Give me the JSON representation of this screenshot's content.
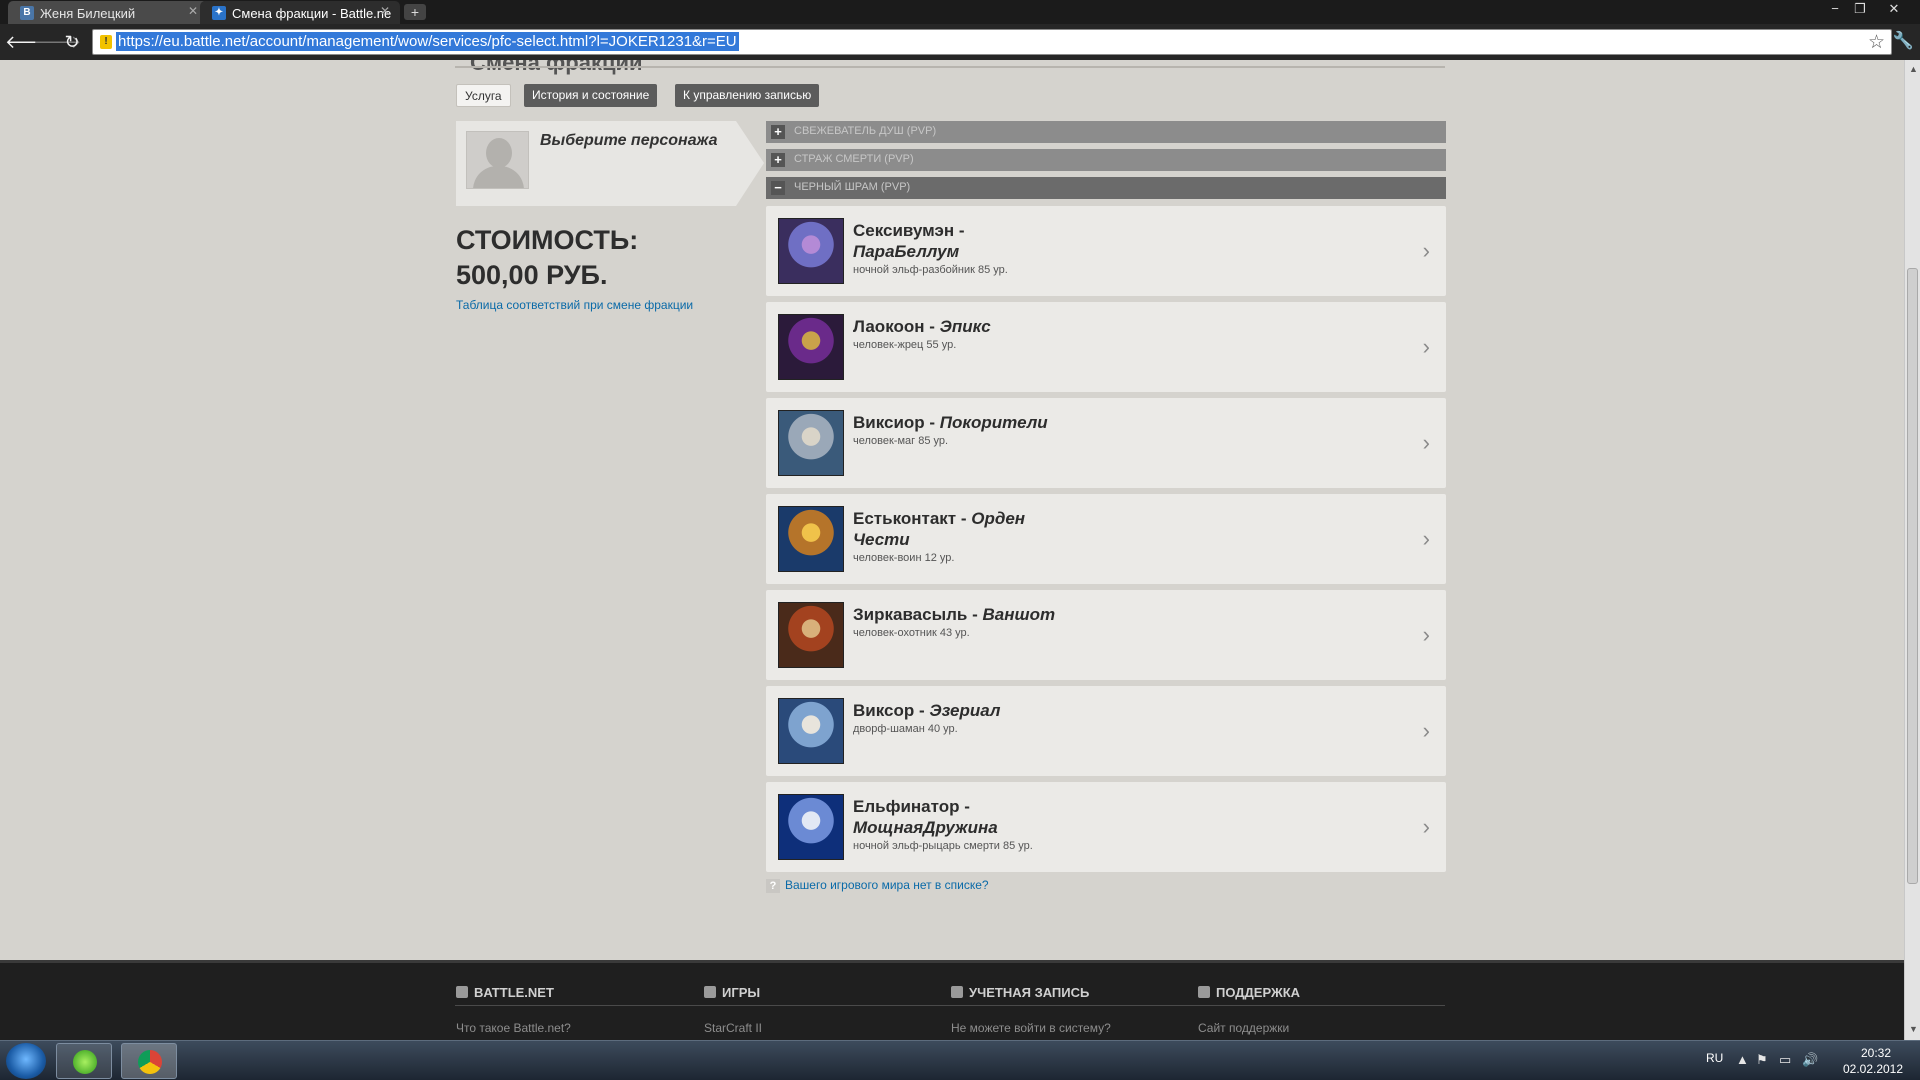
{
  "browser": {
    "tabs": [
      {
        "label": "Женя Билецкий",
        "favicon": "B",
        "favicon_color": "#4a76a8",
        "active": false
      },
      {
        "label": "Смена фракции - Battle.ne",
        "favicon": "✦",
        "favicon_color": "#2a73c9",
        "active": true
      }
    ],
    "new_tab": "+",
    "url": "https://eu.battle.net/account/management/wow/services/pfc-select.html?l=JOKER1231&r=EU",
    "window_controls": {
      "minimize": "−",
      "restore": "❐",
      "close": "✕"
    }
  },
  "page": {
    "header_title": "Смена фракции",
    "tabs": {
      "service": "Услуга",
      "history": "История и состояние",
      "manage": "К управлению записью"
    },
    "select_character": "Выберите персонажа",
    "price_title": "СТОИМОСТЬ:",
    "price_value": "500,00 РУБ.",
    "faction_table_link": "Таблица соответствий при смене фракции",
    "realms": [
      {
        "name": "СВЕЖЕВАТЕЛЬ ДУШ (PVP)",
        "toggle": "+",
        "expanded": false
      },
      {
        "name": "СТРАЖ СМЕРТИ (PVP)",
        "toggle": "+",
        "expanded": false
      },
      {
        "name": "ЧЕРНЫЙ ШРАМ (PVP)",
        "toggle": "−",
        "expanded": true
      }
    ],
    "characters": [
      {
        "name": "Сексивумэн - ",
        "guild": "ПараБеллум",
        "meta": "ночной эльф-разбойник 85 ур.",
        "portrait_colors": [
          "#3a2e5e",
          "#6f6fc4",
          "#b48ad6"
        ]
      },
      {
        "name": "Лаокоон - ",
        "guild": "Эпикс",
        "meta": "человек-жрец 55 ур.",
        "portrait_colors": [
          "#2b1a3a",
          "#6a2a8a",
          "#c9a24a"
        ]
      },
      {
        "name": "Виксиор - ",
        "guild": "Покорители",
        "meta": "человек-маг 85 ур.",
        "portrait_colors": [
          "#3a5a7a",
          "#9aa8b8",
          "#d9d4c8"
        ]
      },
      {
        "name": "Естьконтакт - ",
        "guild": "Орден Чести",
        "meta": "человек-воин 12 ур.",
        "portrait_colors": [
          "#1a3a6a",
          "#b5742a",
          "#f0c24a"
        ]
      },
      {
        "name": "Зиркавасыль - ",
        "guild": "Ваншот",
        "meta": "человек-охотник 43 ур.",
        "portrait_colors": [
          "#4a2a1a",
          "#a3421f",
          "#d8b07a"
        ]
      },
      {
        "name": "Виксор - ",
        "guild": "Эзериал",
        "meta": "дворф-шаман 40 ур.",
        "portrait_colors": [
          "#2a4a7a",
          "#7ea3cf",
          "#e8e4dc"
        ]
      },
      {
        "name": "Ельфинатор - ",
        "guild": "МощнаяДружина",
        "meta": "ночной эльф-рыцарь смерти 85 ур.",
        "portrait_colors": [
          "#0e2f7a",
          "#6b8ad4",
          "#e2e8f4"
        ]
      }
    ],
    "missing_realm_icon": "?",
    "missing_realm": "Вашего игрового мира нет в списке?"
  },
  "footer": {
    "columns": [
      {
        "title": "BATTLE.NET",
        "link": "Что такое Battle.net?"
      },
      {
        "title": "ИГРЫ",
        "link": "StarCraft II"
      },
      {
        "title": "УЧЕТНАЯ ЗАПИСЬ",
        "link": "Не можете войти в систему?"
      },
      {
        "title": "ПОДДЕРЖКА",
        "link": "Сайт поддержки"
      }
    ]
  },
  "taskbar": {
    "language": "RU",
    "time": "20:32",
    "date": "02.02.2012"
  }
}
